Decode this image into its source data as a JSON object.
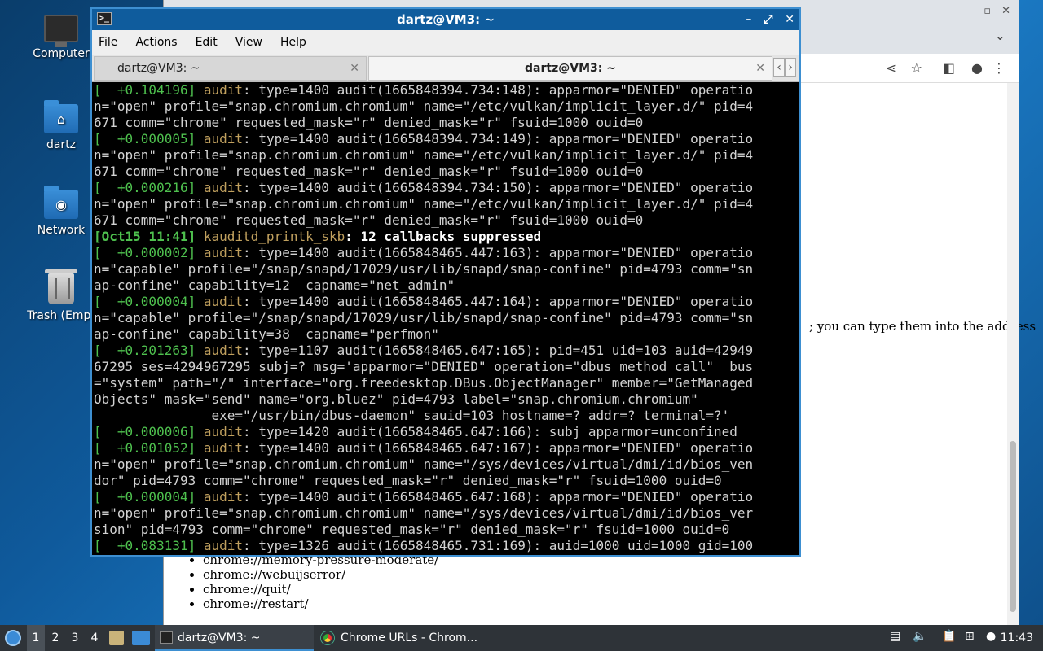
{
  "desktop": {
    "icons": [
      {
        "label": "Computer"
      },
      {
        "label": "dartz"
      },
      {
        "label": "Network"
      },
      {
        "label": "Trash (Empt"
      }
    ]
  },
  "browser": {
    "content_text": "; you can type them into the address",
    "list_items": [
      "chrome://memory-pressure-moderate/",
      "chrome://webuijserror/",
      "chrome://quit/",
      "chrome://restart/"
    ]
  },
  "terminal": {
    "title": "dartz@VM3: ~",
    "menu": [
      "File",
      "Actions",
      "Edit",
      "View",
      "Help"
    ],
    "tabs": [
      {
        "label": "dartz@VM3: ~"
      },
      {
        "label": "dartz@VM3: ~"
      }
    ],
    "lines": [
      {
        "ts": "[  +0.104196]",
        "aud": "audit",
        "rest": ": type=1400 audit(1665848394.734:148): apparmor=\"DENIED\" operatio"
      },
      {
        "plain": "n=\"open\" profile=\"snap.chromium.chromium\" name=\"/etc/vulkan/implicit_layer.d/\" pid=4"
      },
      {
        "plain": "671 comm=\"chrome\" requested_mask=\"r\" denied_mask=\"r\" fsuid=1000 ouid=0"
      },
      {
        "ts": "[  +0.000005]",
        "aud": "audit",
        "rest": ": type=1400 audit(1665848394.734:149): apparmor=\"DENIED\" operatio"
      },
      {
        "plain": "n=\"open\" profile=\"snap.chromium.chromium\" name=\"/etc/vulkan/implicit_layer.d/\" pid=4"
      },
      {
        "plain": "671 comm=\"chrome\" requested_mask=\"r\" denied_mask=\"r\" fsuid=1000 ouid=0"
      },
      {
        "ts": "[  +0.000216]",
        "aud": "audit",
        "rest": ": type=1400 audit(1665848394.734:150): apparmor=\"DENIED\" operatio"
      },
      {
        "plain": "n=\"open\" profile=\"snap.chromium.chromium\" name=\"/etc/vulkan/implicit_layer.d/\" pid=4"
      },
      {
        "plain": "671 comm=\"chrome\" requested_mask=\"r\" denied_mask=\"r\" fsuid=1000 ouid=0"
      },
      {
        "bts": "[Oct15 11:41]",
        "kaud": " kauditd_printk_skb",
        "bold": ": 12 callbacks suppressed"
      },
      {
        "ts": "[  +0.000002]",
        "aud": "audit",
        "rest": ": type=1400 audit(1665848465.447:163): apparmor=\"DENIED\" operatio"
      },
      {
        "plain": "n=\"capable\" profile=\"/snap/snapd/17029/usr/lib/snapd/snap-confine\" pid=4793 comm=\"sn"
      },
      {
        "plain": "ap-confine\" capability=12  capname=\"net_admin\""
      },
      {
        "ts": "[  +0.000004]",
        "aud": "audit",
        "rest": ": type=1400 audit(1665848465.447:164): apparmor=\"DENIED\" operatio"
      },
      {
        "plain": "n=\"capable\" profile=\"/snap/snapd/17029/usr/lib/snapd/snap-confine\" pid=4793 comm=\"sn"
      },
      {
        "plain": "ap-confine\" capability=38  capname=\"perfmon\""
      },
      {
        "ts": "[  +0.201263]",
        "aud": "audit",
        "rest": ": type=1107 audit(1665848465.647:165): pid=451 uid=103 auid=42949"
      },
      {
        "plain": "67295 ses=4294967295 subj=? msg='apparmor=\"DENIED\" operation=\"dbus_method_call\"  bus"
      },
      {
        "plain": "=\"system\" path=\"/\" interface=\"org.freedesktop.DBus.ObjectManager\" member=\"GetManaged"
      },
      {
        "plain": "Objects\" mask=\"send\" name=\"org.bluez\" pid=4793 label=\"snap.chromium.chromium\""
      },
      {
        "plain": "               exe=\"/usr/bin/dbus-daemon\" sauid=103 hostname=? addr=? terminal=?'"
      },
      {
        "ts": "[  +0.000006]",
        "aud": "audit",
        "rest": ": type=1420 audit(1665848465.647:166): subj_apparmor=unconfined"
      },
      {
        "ts": "[  +0.001052]",
        "aud": "audit",
        "rest": ": type=1400 audit(1665848465.647:167): apparmor=\"DENIED\" operatio"
      },
      {
        "plain": "n=\"open\" profile=\"snap.chromium.chromium\" name=\"/sys/devices/virtual/dmi/id/bios_ven"
      },
      {
        "plain": "dor\" pid=4793 comm=\"chrome\" requested_mask=\"r\" denied_mask=\"r\" fsuid=1000 ouid=0"
      },
      {
        "ts": "[  +0.000004]",
        "aud": "audit",
        "rest": ": type=1400 audit(1665848465.647:168): apparmor=\"DENIED\" operatio"
      },
      {
        "plain": "n=\"open\" profile=\"snap.chromium.chromium\" name=\"/sys/devices/virtual/dmi/id/bios_ver"
      },
      {
        "plain": "sion\" pid=4793 comm=\"chrome\" requested_mask=\"r\" denied_mask=\"r\" fsuid=1000 ouid=0"
      },
      {
        "ts": "[  +0.083131]",
        "aud": "audit",
        "rest": ": type=1326 audit(1665848465.731:169): auid=1000 uid=1000 gid=100"
      }
    ]
  },
  "taskbar": {
    "workspaces": [
      "1",
      "2",
      "3",
      "4"
    ],
    "tasks": [
      {
        "label": "dartz@VM3: ~"
      },
      {
        "label": "Chrome URLs - Chrom..."
      }
    ],
    "clock": "11:43"
  },
  "colors": {
    "terminal_border": "#3d8fd1",
    "title_bar": "#0f5c9d",
    "timestamp": "#4ec04e",
    "audit": "#c0a05e"
  }
}
